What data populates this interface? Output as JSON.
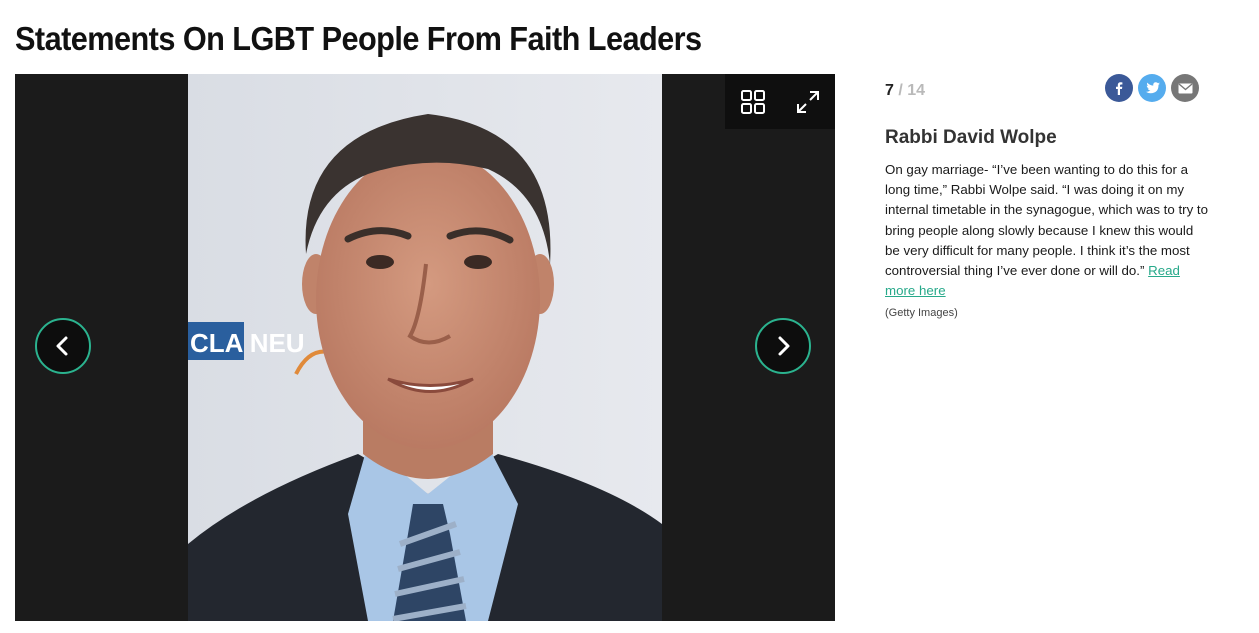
{
  "page": {
    "title": "Statements On LGBT People From Faith Leaders"
  },
  "gallery": {
    "current": "7",
    "separator": "/",
    "total": "14",
    "photo_backdrop_text": "CLA NEU",
    "share_icons": [
      "facebook-icon",
      "twitter-icon",
      "email-icon"
    ],
    "toolbar_icons": [
      "grid-icon",
      "expand-icon"
    ],
    "nav_icons": [
      "chevron-left-icon",
      "chevron-right-icon"
    ],
    "colors": {
      "accent": "#2bb38f",
      "facebook": "#3b5998",
      "twitter": "#55acee",
      "email": "#777777",
      "viewer_bg": "#1b1b1b"
    }
  },
  "slide": {
    "title": "Rabbi David Wolpe",
    "body": "On gay marriage- “I’ve been wanting to do this for a long time,” Rabbi Wolpe said. “I was doing it on my internal timetable in the synagogue, which was to try to bring people along slowly because I knew this would be very difficult for many people. I think it’s the most controversial thing I’ve ever done or will do.”",
    "read_more": "Read more here",
    "credit": "(Getty Images)"
  }
}
